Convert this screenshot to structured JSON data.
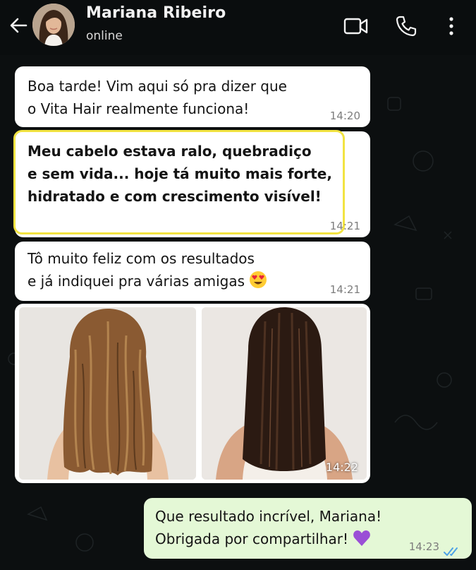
{
  "header": {
    "name": "Mariana Ribeiro",
    "status": "online",
    "icons": [
      "back-arrow-icon",
      "video-camera-icon",
      "phone-icon",
      "more-vert-icon"
    ]
  },
  "colors": {
    "header_bg": "#0a0d0e",
    "chat_bg": "#0c0f10",
    "incoming_bubble": "#ffffff",
    "outgoing_bubble": "#e4f8d6",
    "highlight": "#f2e341",
    "read_ticks": "#4fa3e6"
  },
  "messages": [
    {
      "direction": "incoming",
      "lines": [
        "Boa tarde! Vim aqui só pra dizer que",
        "o Vita Hair realmente funciona!"
      ],
      "time": "14:20"
    },
    {
      "direction": "incoming",
      "highlighted": true,
      "lines": [
        "Meu cabelo estava ralo, quebradiço",
        "e sem vida... hoje tá muito mais forte,",
        "hidratado e com crescimento visível!"
      ],
      "time": "14:21"
    },
    {
      "direction": "incoming",
      "lines": [
        "Tô muito feliz com os resultados",
        "e já indiquei pra várias amigas"
      ],
      "emoji": "heart-eyes-emoji",
      "time": "14:21"
    },
    {
      "direction": "incoming",
      "type": "image",
      "images": [
        "hair-before-photo",
        "hair-after-photo"
      ],
      "time": "14:22"
    },
    {
      "direction": "outgoing",
      "lines": [
        "Que resultado incrível, Mariana!",
        "Obrigada por compartilhar!"
      ],
      "emoji": "purple-heart-emoji",
      "time": "14:23",
      "read": true
    }
  ]
}
